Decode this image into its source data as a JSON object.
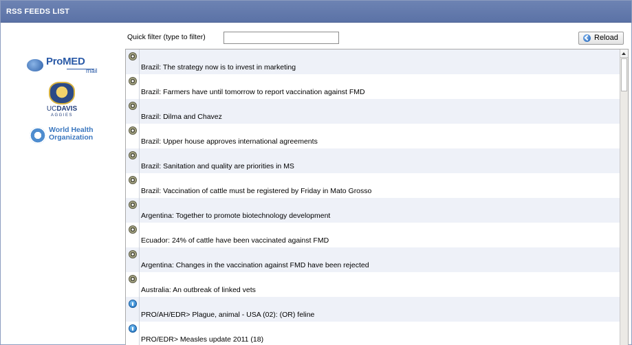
{
  "panel": {
    "title": "RSS FEEDS LIST"
  },
  "toolbar": {
    "filter_label": "Quick filter (type to filter)",
    "filter_value": "",
    "filter_placeholder": "",
    "reload_label": "Reload"
  },
  "sidebar": {
    "promed": {
      "name": "ProMED",
      "sub": "mail"
    },
    "ucdavis": {
      "name_uc": "UC",
      "name_davis": "DAVIS",
      "sub": "AGGIES"
    },
    "who": {
      "line1": "World Health",
      "line2": "Organization"
    }
  },
  "feeds": [
    {
      "icon": "eye-icon",
      "title": "Brazil: The strategy now is to invest in marketing"
    },
    {
      "icon": "eye-icon",
      "title": "Brazil: Farmers have until tomorrow to report vaccination against FMD"
    },
    {
      "icon": "eye-icon",
      "title": "Brazil: Dilma and Chavez"
    },
    {
      "icon": "eye-icon",
      "title": "Brazil: Upper house approves international agreements"
    },
    {
      "icon": "eye-icon",
      "title": "Brazil: Sanitation and quality are priorities in MS"
    },
    {
      "icon": "eye-icon",
      "title": "Brazil: Vaccination of cattle must be registered by Friday in Mato Grosso"
    },
    {
      "icon": "eye-icon",
      "title": "Argentina: Together to promote biotechnology development"
    },
    {
      "icon": "eye-icon",
      "title": "Ecuador: 24% of cattle have been vaccinated against FMD"
    },
    {
      "icon": "eye-icon",
      "title": "Argentina: Changes in the vaccination against FMD have been rejected"
    },
    {
      "icon": "eye-icon",
      "title": "Australia: An outbreak of linked vets"
    },
    {
      "icon": "info-icon",
      "title": "PRO/AH/EDR> Plague, animal  - USA (02): (OR) feline"
    },
    {
      "icon": "info-icon",
      "title": "PRO/EDR> Measles update 2011 (18)"
    }
  ]
}
